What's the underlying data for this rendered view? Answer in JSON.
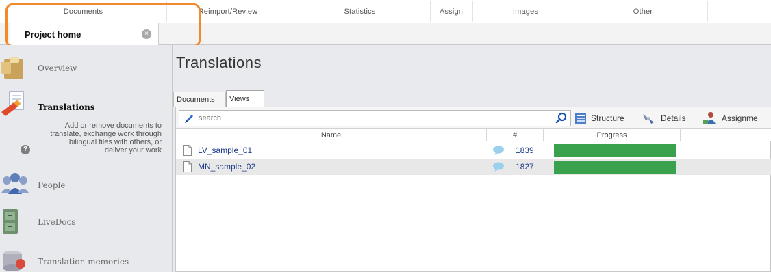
{
  "ribbon": {
    "tabs": [
      "Documents",
      "Reimport/Review",
      "Statistics",
      "Assign",
      "Images",
      "Other"
    ]
  },
  "doc_tab": {
    "label": "Project home",
    "close_glyph": "×"
  },
  "sidebar": {
    "items": [
      {
        "label": "Overview",
        "icon": "overview-icon",
        "active": false
      },
      {
        "label": "Translations",
        "icon": "translations-icon",
        "active": true
      },
      {
        "label": "People",
        "icon": "people-icon",
        "active": false
      },
      {
        "label": "LiveDocs",
        "icon": "livedocs-icon",
        "active": false
      },
      {
        "label": "Translation memories",
        "icon": "translation-memories-icon",
        "active": false
      }
    ],
    "description": "Add or remove documents to translate, exchange work through bilingual files with others, or deliver your work",
    "help_glyph": "?"
  },
  "main": {
    "title": "Translations",
    "subtabs": [
      {
        "label": "Documents",
        "active": false
      },
      {
        "label": "Views",
        "active": true
      }
    ],
    "search": {
      "placeholder": "search",
      "value": ""
    },
    "toolbar": {
      "structure_label": "Structure",
      "details_label": "Details",
      "assignments_label": "Assignme"
    },
    "grid": {
      "columns": [
        "Name",
        "#",
        "Progress"
      ],
      "rows": [
        {
          "name": "LV_sample_01",
          "count": "1839",
          "progress": 1.0
        },
        {
          "name": "MN_sample_02",
          "count": "1827",
          "progress": 1.0
        }
      ]
    }
  },
  "colors": {
    "highlight": "#f08a2b",
    "progress": "#3aa24c",
    "link": "#1e3c8c",
    "sidebar_bg": "#e8e9ec"
  }
}
